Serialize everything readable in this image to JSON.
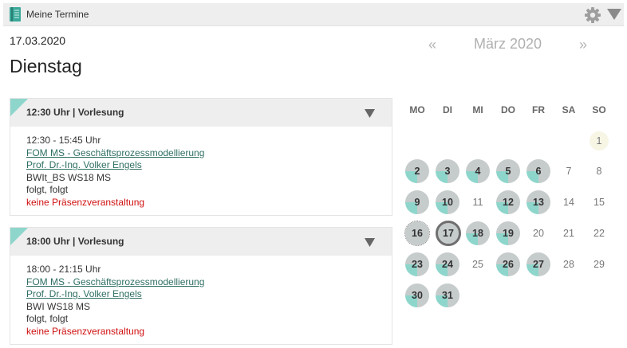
{
  "topbar": {
    "title": "Meine Termine"
  },
  "date_short": "17.03.2020",
  "day_name": "Dienstag",
  "events": [
    {
      "header": "12:30 Uhr | Vorlesung",
      "time": "12:30 - 15:45 Uhr",
      "course": "FOM MS - Geschäftsprozessmodellierung",
      "lecturer": "Prof. Dr.-Ing. Volker Engels",
      "group": "BWIt_BS WS18 MS",
      "status": "folgt, folgt",
      "note": "keine Präsenzveranstaltung"
    },
    {
      "header": "18:00 Uhr | Vorlesung",
      "time": "18:00 - 21:15 Uhr",
      "course": "FOM MS - Geschäftsprozessmodellierung",
      "lecturer": "Prof. Dr.-Ing. Volker Engels",
      "group": "BWI WS18 MS",
      "status": "folgt, folgt",
      "note": "keine Präsenzveranstaltung"
    }
  ],
  "calendar": {
    "prev": "«",
    "month": "März 2020",
    "next": "»",
    "weekdays": [
      "MO",
      "DI",
      "MI",
      "DO",
      "FR",
      "SA",
      "SO"
    ],
    "days": [
      "1",
      "2",
      "3",
      "4",
      "5",
      "6",
      "7",
      "8",
      "9",
      "10",
      "11",
      "12",
      "13",
      "14",
      "15",
      "16",
      "17",
      "18",
      "19",
      "20",
      "21",
      "22",
      "23",
      "24",
      "25",
      "26",
      "27",
      "28",
      "29",
      "30",
      "31"
    ]
  },
  "colors": {
    "accent": "#8ed6cc",
    "circle": "#c6cbcb",
    "link": "#2f6f63",
    "alert": "#d01010"
  },
  "icons": {
    "app": "book-icon",
    "settings": "gear-icon",
    "collapse": "triangle-down-icon"
  }
}
